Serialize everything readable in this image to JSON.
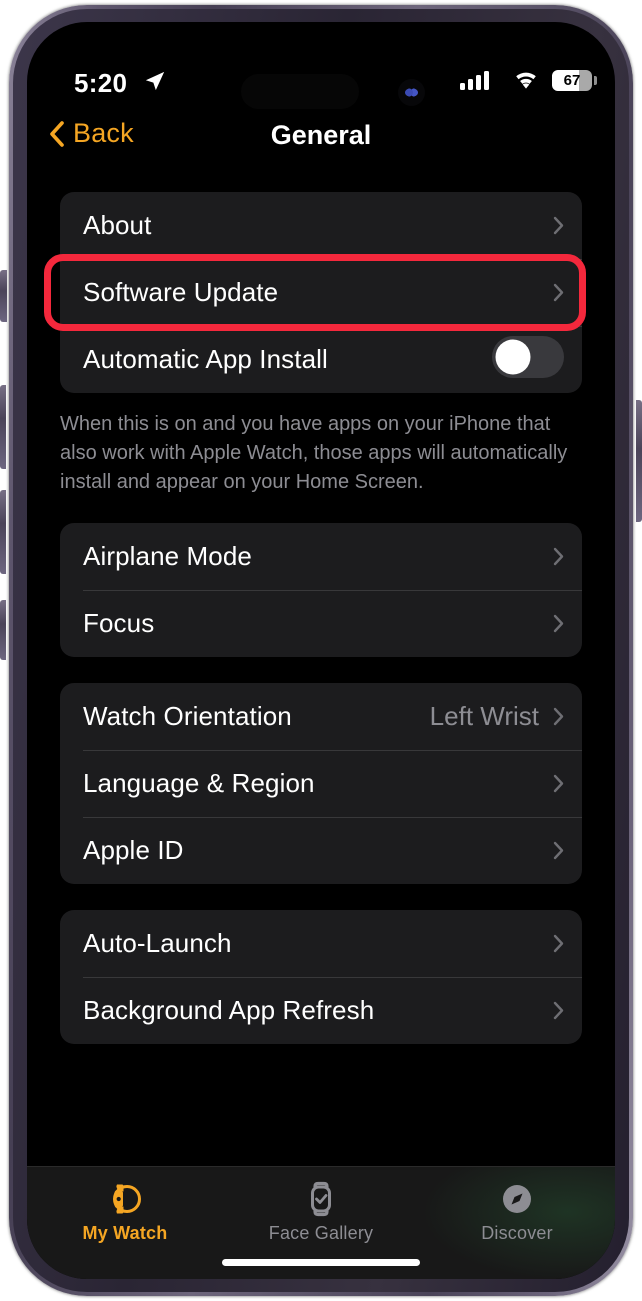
{
  "status_bar": {
    "time": "5:20",
    "location_icon": "location-arrow-icon",
    "cellular_icon": "cellular-bars-icon",
    "wifi_icon": "wifi-icon",
    "battery_level": "67",
    "battery_percent": 67
  },
  "nav": {
    "back_label": "Back",
    "back_icon": "chevron-left-icon",
    "title": "General"
  },
  "accent_color": "#F5A623",
  "highlight_color": "#F4283C",
  "groups": [
    {
      "rows": [
        {
          "label": "About",
          "type": "disclosure",
          "value": ""
        },
        {
          "label": "Software Update",
          "type": "disclosure",
          "value": "",
          "highlighted": true
        },
        {
          "label": "Automatic App Install",
          "type": "toggle",
          "toggle_on": false
        }
      ],
      "footer": "When this is on and you have apps on your iPhone that also work with Apple Watch, those apps will automatically install and appear on your Home Screen."
    },
    {
      "rows": [
        {
          "label": "Airplane Mode",
          "type": "disclosure",
          "value": ""
        },
        {
          "label": "Focus",
          "type": "disclosure",
          "value": ""
        }
      ],
      "footer": ""
    },
    {
      "rows": [
        {
          "label": "Watch Orientation",
          "type": "disclosure",
          "value": "Left Wrist"
        },
        {
          "label": "Language & Region",
          "type": "disclosure",
          "value": ""
        },
        {
          "label": "Apple ID",
          "type": "disclosure",
          "value": ""
        }
      ],
      "footer": ""
    },
    {
      "rows": [
        {
          "label": "Auto-Launch",
          "type": "disclosure",
          "value": ""
        },
        {
          "label": "Background App Refresh",
          "type": "disclosure",
          "value": ""
        }
      ],
      "footer": ""
    }
  ],
  "tab_bar": {
    "tabs": [
      {
        "label": "My Watch",
        "icon": "watch-icon",
        "active": true
      },
      {
        "label": "Face Gallery",
        "icon": "watch-face-check-icon",
        "active": false
      },
      {
        "label": "Discover",
        "icon": "compass-icon",
        "active": false
      }
    ]
  }
}
